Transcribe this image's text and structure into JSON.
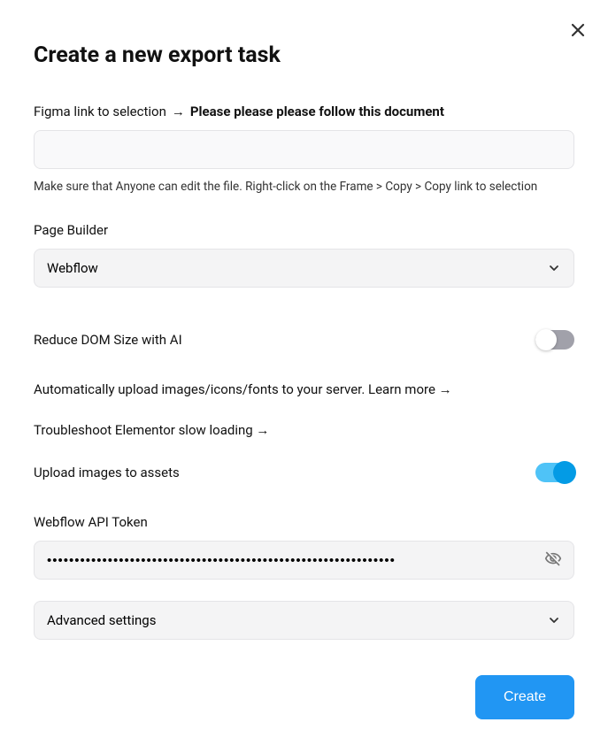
{
  "title": "Create a new export task",
  "figma": {
    "label": "Figma link to selection",
    "followDoc": "Please please please follow this document",
    "value": "",
    "helper": "Make sure that Anyone can edit the file. Right-click on the Frame > Copy > Copy link to selection"
  },
  "pageBuilder": {
    "label": "Page Builder",
    "selected": "Webflow"
  },
  "reduceDom": {
    "label": "Reduce DOM Size with AI",
    "enabled": false
  },
  "links": {
    "autoUpload": "Automatically upload images/icons/fonts to your server. Learn more →",
    "troubleshoot": "Troubleshoot Elementor slow loading →"
  },
  "uploadImages": {
    "label": "Upload images to assets",
    "enabled": true
  },
  "apiToken": {
    "label": "Webflow API Token",
    "maskedValue": "•••••••••••••••••••••••••••••••••••••••••••••••••••••••••••••••"
  },
  "advanced": {
    "label": "Advanced settings"
  },
  "buttons": {
    "create": "Create"
  }
}
